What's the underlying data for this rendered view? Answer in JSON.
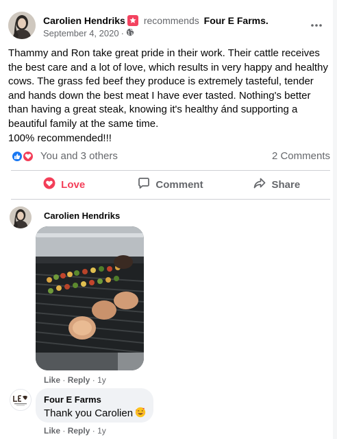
{
  "post": {
    "author": "Carolien Hendriks",
    "action_text": "recommends",
    "page_name": "Four E Farms.",
    "date": "September 4, 2020",
    "meta_separator": "·",
    "body_lines": [
      "Thammy and Ron take great pride in their work. Their cattle receives",
      "the best care and a lot of love, which results in very happy and healthy",
      "cows. The grass fed beef they produce is extremely tasteful, tender",
      "and hands down the best meat I have ever tasted. Nothing's better",
      "than having a great steak, knowing it's healthy ánd supporting a",
      "beautiful family at the same time.",
      "100% recommended!!!"
    ],
    "icons": {
      "recommend": "recommend-badge-icon",
      "privacy": "globe-icon",
      "more": "more-options-icon"
    }
  },
  "reactions": {
    "summary": "You and 3 others",
    "comments": "2 Comments",
    "icons": [
      "like-reaction-icon",
      "love-reaction-icon"
    ]
  },
  "actions": {
    "love": "Love",
    "comment": "Comment",
    "share": "Share"
  },
  "comments": [
    {
      "author": "Carolien Hendriks",
      "like": "Like",
      "reply": "Reply",
      "separator": "·",
      "time": "1y"
    },
    {
      "author": "Four E Farms",
      "text": "Thank you Carolien",
      "emoji": "smiling-face-with-hearts-emoji",
      "like": "Like",
      "reply": "Reply",
      "separator": "·",
      "time": "1y"
    }
  ],
  "colors": {
    "love": "#f33e58",
    "like": "#1877f2",
    "secondary_text": "#65676b",
    "bubble": "#f0f2f5",
    "divider": "#ced0d4"
  }
}
